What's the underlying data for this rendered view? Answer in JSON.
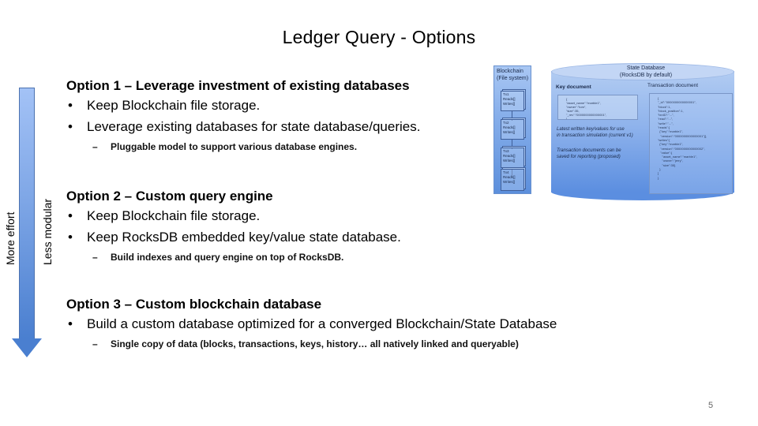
{
  "slide": {
    "title": "Ledger Query - Options",
    "page_number": "5"
  },
  "effort_arrow": {
    "label_left": "More effort",
    "label_right": "Less modular",
    "colors": {
      "top": "#a3c2f6",
      "bottom": "#4a7fd0",
      "border": "#4c72b0"
    }
  },
  "options": [
    {
      "heading": "Option 1 – Leverage investment of existing databases",
      "bullets": [
        "Keep Blockchain file storage.",
        "Leverage existing databases for state database/queries."
      ],
      "subpoint": "Pluggable model to support various database engines."
    },
    {
      "heading": "Option 2 – Custom query engine",
      "bullets": [
        "Keep Blockchain file storage.",
        "Keep RocksDB embedded key/value state database."
      ],
      "subpoint": "Build indexes and query engine on top of RocksDB."
    },
    {
      "heading": "Option 3 – Custom blockchain database",
      "bullets": [
        "Build a custom database optimized for a converged Blockchain/State Database"
      ],
      "subpoint": "Single copy of data (blocks, transactions, keys, history… all natively linked and queryable)"
    }
  ],
  "diagram": {
    "blockchain": {
      "title_line1": "Blockchain",
      "title_line2": "(File system)",
      "blocks": [
        {
          "line1": "Tx1",
          "line2": "Reads[]",
          "line3": "Writes[]"
        },
        {
          "line1": "Tx2",
          "line2": "Reads[]",
          "line3": "Writes[]"
        },
        {
          "line1": "Tx3",
          "line2": "Reads[]",
          "line3": "Writes[]"
        },
        {
          "line1": "Tx4",
          "line2": "Reads[]",
          "line3": "Writes[]"
        }
      ]
    },
    "state_database": {
      "title_line1": "State Database",
      "title_line2": "(RocksDB by default)",
      "key_document_label": "Key document",
      "transaction_document_label": "Transaction document",
      "key_document_lines": [
        "{",
        "\"asset_name\":\"marble1\",",
        "\"owner\":\"tom\",",
        "\"size\":35,",
        "\"_rev\":\"0000000000000001\",",
        "}"
      ],
      "transaction_document_lines": [
        "{",
        "\"_id\":\"0000000000000001\",",
        "\"block\":1,",
        "\"block_position\":1,",
        "\"txnID\":\"...\",",
        "\"read\":\"...\",",
        "\"write\":\"...\",",
        "\"reads\":[",
        "  {\"key\":\"marble1\",",
        "   \"version\":\"0000000000000001\"}],",
        "\"writes\":[",
        "  {\"key\":\"marble1\",",
        "   \"version\":\"0000000000000002\",",
        "   \"value\":{",
        "     \"asset_name\":\"marble1\",",
        "     \"owner\":\"jerry\",",
        "     \"size\":35}",
        "  }",
        "]",
        "}"
      ],
      "note1_line1": "Latest written key/values for use",
      "note1_line2": "in transaction simulation (current v1)",
      "note2_line1": "Transaction documents can be",
      "note2_line2": "saved for reporting (proposed)"
    }
  }
}
